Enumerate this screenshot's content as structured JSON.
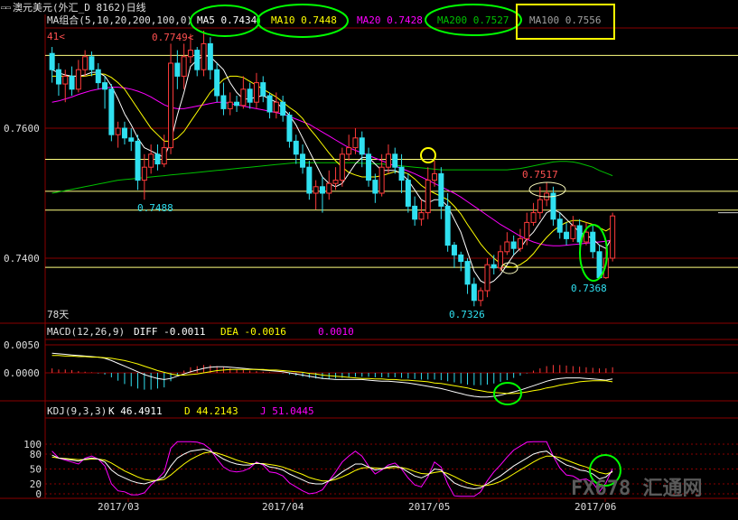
{
  "title": "澳元美元(外汇_D 8162)日线",
  "colors": {
    "bg": "#000000",
    "up": "#ff3b3b",
    "down": "#30e0f0",
    "grid": "#8a0000",
    "ma5": "#ffffff",
    "ma10": "#ffff00",
    "ma20": "#ff00ff",
    "ma200": "#00c000",
    "ma100": "#a0a0a0",
    "hline": "#ffff80",
    "annotate_green": "#00ff00",
    "annotate_yellow": "#ffff00"
  },
  "price_header": {
    "label": "MA组合(5,10,20,200,100,0)",
    "items": [
      {
        "text": "MA5 0.7434",
        "color": "#ffffff"
      },
      {
        "text": "MA10 0.7448",
        "color": "#ffff00"
      },
      {
        "text": "MA20 0.7428",
        "color": "#ff00ff"
      },
      {
        "text": "MA200 0.7527",
        "color": "#00c000"
      },
      {
        "text": "MA100 0.7556",
        "color": "#a0a0a0"
      }
    ]
  },
  "macd_header": {
    "label": "MACD(12,26,9)",
    "diff": "DIFF  -0.0011",
    "dea": "DEA  -0.0016",
    "macd": "0.0010"
  },
  "kdj_header": {
    "label": "KDJ(9,3,3)",
    "k": "K  46.4911",
    "d": "D  44.2143",
    "j": "J  51.0445"
  },
  "chart_data": {
    "type": "candlestick",
    "price_ticks": [
      "0.7600",
      "0.7400"
    ],
    "macd_ticks": [
      "0.0050",
      "0.0000"
    ],
    "kdj_ticks": [
      "100",
      "80",
      "50",
      "20",
      "0"
    ],
    "x_ticks": [
      "2017/03",
      "2017/04",
      "2017/05",
      "2017/06"
    ],
    "annotations": [
      "0.7749",
      "0.7488",
      "0.7517",
      "0.7326",
      "0.7368"
    ],
    "period_label": "78天",
    "price_left_label": "41",
    "horizontal_levels": [
      0.7712,
      0.7552,
      0.7503,
      0.7474,
      0.7386
    ],
    "candles": [
      [
        0.7715,
        0.769,
        0.7725,
        0.767
      ],
      [
        0.769,
        0.7668,
        0.77,
        0.765
      ],
      [
        0.7668,
        0.768,
        0.769,
        0.764
      ],
      [
        0.768,
        0.766,
        0.7695,
        0.765
      ],
      [
        0.766,
        0.769,
        0.7705,
        0.7655
      ],
      [
        0.769,
        0.771,
        0.772,
        0.768
      ],
      [
        0.771,
        0.769,
        0.7718,
        0.768
      ],
      [
        0.769,
        0.767,
        0.77,
        0.766
      ],
      [
        0.767,
        0.766,
        0.768,
        0.763
      ],
      [
        0.766,
        0.759,
        0.7668,
        0.758
      ],
      [
        0.759,
        0.76,
        0.761,
        0.757
      ],
      [
        0.76,
        0.7585,
        0.761,
        0.7575
      ],
      [
        0.7585,
        0.758,
        0.76,
        0.7565
      ],
      [
        0.758,
        0.752,
        0.759,
        0.7505
      ],
      [
        0.752,
        0.754,
        0.756,
        0.749
      ],
      [
        0.754,
        0.756,
        0.7575,
        0.753
      ],
      [
        0.756,
        0.7545,
        0.7575,
        0.7535
      ],
      [
        0.7545,
        0.757,
        0.759,
        0.754
      ],
      [
        0.757,
        0.77,
        0.773,
        0.756
      ],
      [
        0.77,
        0.768,
        0.772,
        0.766
      ],
      [
        0.768,
        0.771,
        0.773,
        0.766
      ],
      [
        0.771,
        0.772,
        0.7745,
        0.77
      ],
      [
        0.772,
        0.769,
        0.7725,
        0.768
      ],
      [
        0.769,
        0.773,
        0.775,
        0.768
      ],
      [
        0.773,
        0.769,
        0.774,
        0.7675
      ],
      [
        0.769,
        0.765,
        0.77,
        0.764
      ],
      [
        0.765,
        0.763,
        0.767,
        0.762
      ],
      [
        0.763,
        0.764,
        0.7655,
        0.762
      ],
      [
        0.764,
        0.7635,
        0.765,
        0.7625
      ],
      [
        0.7635,
        0.766,
        0.768,
        0.763
      ],
      [
        0.766,
        0.764,
        0.767,
        0.763
      ],
      [
        0.764,
        0.767,
        0.7685,
        0.763
      ],
      [
        0.767,
        0.765,
        0.768,
        0.764
      ],
      [
        0.765,
        0.7625,
        0.7655,
        0.7615
      ],
      [
        0.7625,
        0.764,
        0.7655,
        0.7615
      ],
      [
        0.764,
        0.762,
        0.765,
        0.761
      ],
      [
        0.762,
        0.758,
        0.7625,
        0.757
      ],
      [
        0.758,
        0.756,
        0.759,
        0.7545
      ],
      [
        0.756,
        0.754,
        0.7575,
        0.753
      ],
      [
        0.754,
        0.75,
        0.755,
        0.749
      ],
      [
        0.75,
        0.751,
        0.752,
        0.7475
      ],
      [
        0.751,
        0.75,
        0.7525,
        0.747
      ],
      [
        0.75,
        0.7515,
        0.7535,
        0.749
      ],
      [
        0.7515,
        0.752,
        0.754,
        0.7505
      ],
      [
        0.752,
        0.756,
        0.757,
        0.751
      ],
      [
        0.756,
        0.757,
        0.759,
        0.755
      ],
      [
        0.757,
        0.7585,
        0.76,
        0.756
      ],
      [
        0.7585,
        0.756,
        0.7595,
        0.754
      ],
      [
        0.756,
        0.752,
        0.757,
        0.751
      ],
      [
        0.752,
        0.75,
        0.753,
        0.7485
      ],
      [
        0.75,
        0.754,
        0.756,
        0.7495
      ],
      [
        0.754,
        0.756,
        0.7575,
        0.753
      ],
      [
        0.756,
        0.754,
        0.757,
        0.753
      ],
      [
        0.754,
        0.752,
        0.756,
        0.75
      ],
      [
        0.752,
        0.748,
        0.753,
        0.747
      ],
      [
        0.748,
        0.746,
        0.7495,
        0.745
      ],
      [
        0.746,
        0.747,
        0.749,
        0.745
      ],
      [
        0.747,
        0.752,
        0.754,
        0.746
      ],
      [
        0.752,
        0.753,
        0.755,
        0.751
      ],
      [
        0.753,
        0.748,
        0.754,
        0.746
      ],
      [
        0.748,
        0.742,
        0.75,
        0.741
      ],
      [
        0.742,
        0.7405,
        0.7425,
        0.7385
      ],
      [
        0.7405,
        0.7395,
        0.741,
        0.738
      ],
      [
        0.7395,
        0.736,
        0.74,
        0.7345
      ],
      [
        0.736,
        0.7335,
        0.737,
        0.7326
      ],
      [
        0.7335,
        0.735,
        0.7355,
        0.7326
      ],
      [
        0.735,
        0.739,
        0.74,
        0.734
      ],
      [
        0.739,
        0.7385,
        0.7405,
        0.7375
      ],
      [
        0.7385,
        0.741,
        0.742,
        0.738
      ],
      [
        0.741,
        0.7425,
        0.744,
        0.7405
      ],
      [
        0.7425,
        0.7415,
        0.7435,
        0.7405
      ],
      [
        0.7415,
        0.743,
        0.7445,
        0.741
      ],
      [
        0.743,
        0.7455,
        0.747,
        0.742
      ],
      [
        0.7455,
        0.747,
        0.7485,
        0.745
      ],
      [
        0.747,
        0.749,
        0.751,
        0.746
      ],
      [
        0.749,
        0.75,
        0.7517,
        0.748
      ],
      [
        0.75,
        0.746,
        0.751,
        0.745
      ],
      [
        0.746,
        0.744,
        0.747,
        0.743
      ],
      [
        0.744,
        0.743,
        0.7455,
        0.742
      ],
      [
        0.743,
        0.745,
        0.7465,
        0.7425
      ],
      [
        0.745,
        0.7425,
        0.746,
        0.742
      ],
      [
        0.7425,
        0.744,
        0.7455,
        0.742
      ],
      [
        0.744,
        0.741,
        0.745,
        0.74
      ],
      [
        0.741,
        0.737,
        0.742,
        0.7368
      ],
      [
        0.737,
        0.74,
        0.7415,
        0.7368
      ],
      [
        0.74,
        0.7465,
        0.747,
        0.7395
      ]
    ],
    "ma5": [
      0.769,
      0.7685,
      0.7682,
      0.768,
      0.768,
      0.7682,
      0.7686,
      0.7686,
      0.768,
      0.7665,
      0.7645,
      0.7622,
      0.7605,
      0.7585,
      0.757,
      0.7565,
      0.756,
      0.7555,
      0.758,
      0.762,
      0.7655,
      0.7695,
      0.7705,
      0.7712,
      0.771,
      0.77,
      0.769,
      0.767,
      0.7655,
      0.7645,
      0.7645,
      0.7648,
      0.765,
      0.7645,
      0.764,
      0.763,
      0.762,
      0.7605,
      0.7585,
      0.7565,
      0.7545,
      0.7525,
      0.7515,
      0.751,
      0.7515,
      0.753,
      0.7545,
      0.7555,
      0.7555,
      0.7545,
      0.7535,
      0.7535,
      0.7535,
      0.753,
      0.752,
      0.7505,
      0.749,
      0.7485,
      0.749,
      0.749,
      0.748,
      0.746,
      0.744,
      0.741,
      0.738,
      0.7365,
      0.736,
      0.7365,
      0.7375,
      0.739,
      0.7405,
      0.7415,
      0.743,
      0.744,
      0.7455,
      0.747,
      0.7475,
      0.747,
      0.746,
      0.745,
      0.744,
      0.7435,
      0.743,
      0.742,
      0.7415,
      0.7434
    ],
    "ma10": [
      0.768,
      0.768,
      0.768,
      0.768,
      0.768,
      0.768,
      0.7682,
      0.7684,
      0.7683,
      0.7678,
      0.767,
      0.766,
      0.7645,
      0.763,
      0.7615,
      0.76,
      0.759,
      0.758,
      0.758,
      0.7585,
      0.7595,
      0.761,
      0.7625,
      0.764,
      0.7655,
      0.7665,
      0.7675,
      0.768,
      0.768,
      0.7678,
      0.7672,
      0.7666,
      0.766,
      0.7654,
      0.7648,
      0.764,
      0.7632,
      0.7625,
      0.7615,
      0.76,
      0.7588,
      0.7575,
      0.7562,
      0.755,
      0.754,
      0.7532,
      0.7528,
      0.7525,
      0.7525,
      0.7525,
      0.7527,
      0.753,
      0.7533,
      0.7533,
      0.753,
      0.7522,
      0.7512,
      0.7505,
      0.75,
      0.7495,
      0.749,
      0.748,
      0.7468,
      0.7452,
      0.7437,
      0.7422,
      0.741,
      0.74,
      0.7392,
      0.7387,
      0.7386,
      0.739,
      0.7397,
      0.7407,
      0.742,
      0.7432,
      0.7442,
      0.745,
      0.7455,
      0.7458,
      0.7458,
      0.7455,
      0.7452,
      0.7447,
      0.7442,
      0.7448
    ],
    "ma20": [
      0.764,
      0.7642,
      0.7645,
      0.7648,
      0.7652,
      0.7655,
      0.7658,
      0.766,
      0.7662,
      0.7663,
      0.7663,
      0.7662,
      0.766,
      0.7657,
      0.7653,
      0.7648,
      0.7642,
      0.7636,
      0.7632,
      0.763,
      0.763,
      0.7632,
      0.7634,
      0.7636,
      0.7638,
      0.764,
      0.764,
      0.7638,
      0.7636,
      0.7634,
      0.7632,
      0.763,
      0.7628,
      0.7626,
      0.7624,
      0.7622,
      0.7618,
      0.7614,
      0.761,
      0.7606,
      0.76,
      0.7594,
      0.7588,
      0.7582,
      0.7576,
      0.757,
      0.7566,
      0.7562,
      0.7558,
      0.7554,
      0.755,
      0.7546,
      0.7542,
      0.7538,
      0.7534,
      0.753,
      0.7525,
      0.752,
      0.7515,
      0.751,
      0.7505,
      0.75,
      0.7494,
      0.7487,
      0.748,
      0.7473,
      0.7466,
      0.7459,
      0.7452,
      0.7446,
      0.744,
      0.7434,
      0.7429,
      0.7425,
      0.7422,
      0.742,
      0.7419,
      0.7419,
      0.742,
      0.7421,
      0.7422,
      0.7423,
      0.7424,
      0.7425,
      0.7426,
      0.7428
    ],
    "ma200": [
      0.75,
      0.7502,
      0.7504,
      0.7506,
      0.7508,
      0.751,
      0.7512,
      0.7514,
      0.7516,
      0.7518,
      0.752,
      0.7521,
      0.7522,
      0.7523,
      0.7524,
      0.7525,
      0.7526,
      0.7527,
      0.7528,
      0.7529,
      0.753,
      0.7531,
      0.7532,
      0.7533,
      0.7534,
      0.7535,
      0.7536,
      0.7537,
      0.7538,
      0.7539,
      0.754,
      0.7541,
      0.7542,
      0.7543,
      0.7544,
      0.7545,
      0.7546,
      0.7547,
      0.7547,
      0.7547,
      0.7547,
      0.7547,
      0.7547,
      0.7547,
      0.7547,
      0.7547,
      0.7547,
      0.7546,
      0.7546,
      0.7545,
      0.7545,
      0.7544,
      0.7543,
      0.7542,
      0.7541,
      0.754,
      0.7539,
      0.7538,
      0.7537,
      0.7536,
      0.7536,
      0.7536,
      0.7536,
      0.7536,
      0.7536,
      0.7536,
      0.7536,
      0.7536,
      0.7536,
      0.7536,
      0.7537,
      0.7538,
      0.754,
      0.7542,
      0.7544,
      0.7546,
      0.7548,
      0.7549,
      0.7549,
      0.7548,
      0.7546,
      0.7543,
      0.754,
      0.7535,
      0.7531,
      0.7527
    ],
    "macd_hist": [
      0.0008,
      0.0006,
      0.0006,
      0.0005,
      0.0003,
      0.0002,
      0.0001,
      -0.0001,
      -0.0003,
      -0.0008,
      -0.0014,
      -0.002,
      -0.0024,
      -0.0028,
      -0.003,
      -0.003,
      -0.0028,
      -0.0026,
      -0.0015,
      -0.0004,
      0.0004,
      0.001,
      0.0012,
      0.0014,
      0.0014,
      0.0012,
      0.001,
      0.0008,
      0.0006,
      0.0005,
      0.0004,
      0.0003,
      0.0002,
      0.0001,
      0.0,
      -0.0001,
      -0.0003,
      -0.0005,
      -0.0007,
      -0.0009,
      -0.001,
      -0.0011,
      -0.0011,
      -0.001,
      -0.0009,
      -0.0008,
      -0.0007,
      -0.0007,
      -0.0007,
      -0.0008,
      -0.0008,
      -0.0008,
      -0.0008,
      -0.0009,
      -0.001,
      -0.0011,
      -0.0012,
      -0.0012,
      -0.0012,
      -0.0013,
      -0.0015,
      -0.0017,
      -0.0019,
      -0.0021,
      -0.0022,
      -0.0022,
      -0.0021,
      -0.0019,
      -0.0016,
      -0.0013,
      -0.0009,
      -0.0005,
      -0.0001,
      0.0004,
      0.0008,
      0.0012,
      0.0014,
      0.0014,
      0.0013,
      0.0012,
      0.0011,
      0.001,
      0.0009,
      0.0008,
      0.0008,
      0.001
    ],
    "macd_diff": [
      0.0035,
      0.0034,
      0.0033,
      0.0032,
      0.0031,
      0.003,
      0.0029,
      0.0028,
      0.0026,
      0.0022,
      0.0017,
      0.0012,
      0.0007,
      0.0002,
      -0.0003,
      -0.0007,
      -0.001,
      -0.0012,
      -0.001,
      -0.0006,
      -0.0002,
      0.0002,
      0.0005,
      0.0008,
      0.001,
      0.0011,
      0.0011,
      0.001,
      0.0009,
      0.0008,
      0.0007,
      0.0006,
      0.0005,
      0.0004,
      0.0003,
      0.0002,
      0.0,
      -0.0002,
      -0.0004,
      -0.0006,
      -0.0008,
      -0.001,
      -0.0011,
      -0.0012,
      -0.0012,
      -0.0012,
      -0.0012,
      -0.0012,
      -0.0013,
      -0.0014,
      -0.0015,
      -0.0015,
      -0.0016,
      -0.0017,
      -0.0018,
      -0.002,
      -0.0022,
      -0.0024,
      -0.0026,
      -0.0028,
      -0.0031,
      -0.0034,
      -0.0037,
      -0.004,
      -0.0042,
      -0.0043,
      -0.0043,
      -0.0042,
      -0.004,
      -0.0037,
      -0.0034,
      -0.0031,
      -0.0027,
      -0.0023,
      -0.0019,
      -0.0015,
      -0.0012,
      -0.001,
      -0.0009,
      -0.0009,
      -0.0009,
      -0.001,
      -0.0011,
      -0.0012,
      -0.0013,
      -0.0011
    ],
    "macd_dea": [
      0.0031,
      0.0031,
      0.003,
      0.003,
      0.0029,
      0.0029,
      0.0028,
      0.0028,
      0.0027,
      0.0026,
      0.0024,
      0.0022,
      0.0019,
      0.0016,
      0.0012,
      0.0008,
      0.0004,
      0.0001,
      -0.0002,
      -0.0004,
      -0.0004,
      -0.0003,
      -0.0002,
      0.0,
      0.0002,
      0.0004,
      0.0005,
      0.0006,
      0.0006,
      0.0006,
      0.0006,
      0.0006,
      0.0006,
      0.0005,
      0.0005,
      0.0004,
      0.0003,
      0.0002,
      0.0001,
      -0.0001,
      -0.0002,
      -0.0004,
      -0.0005,
      -0.0006,
      -0.0007,
      -0.0008,
      -0.0009,
      -0.001,
      -0.001,
      -0.0011,
      -0.0011,
      -0.0012,
      -0.0012,
      -0.0013,
      -0.0013,
      -0.0014,
      -0.0015,
      -0.0016,
      -0.0018,
      -0.0019,
      -0.0021,
      -0.0023,
      -0.0025,
      -0.0027,
      -0.003,
      -0.0032,
      -0.0034,
      -0.0035,
      -0.0036,
      -0.0037,
      -0.0037,
      -0.0036,
      -0.0034,
      -0.0032,
      -0.003,
      -0.0027,
      -0.0025,
      -0.0022,
      -0.002,
      -0.0018,
      -0.0016,
      -0.0015,
      -0.0014,
      -0.0014,
      -0.0014,
      -0.0016
    ],
    "kdj_k": [
      78,
      72,
      70,
      68,
      66,
      70,
      72,
      70,
      64,
      48,
      38,
      32,
      26,
      22,
      20,
      24,
      28,
      34,
      56,
      72,
      80,
      86,
      88,
      90,
      86,
      78,
      70,
      64,
      60,
      58,
      58,
      62,
      60,
      54,
      52,
      48,
      40,
      34,
      28,
      22,
      20,
      20,
      26,
      34,
      44,
      52,
      60,
      60,
      54,
      48,
      50,
      54,
      56,
      52,
      44,
      36,
      32,
      38,
      50,
      48,
      34,
      22,
      16,
      12,
      10,
      12,
      20,
      28,
      36,
      46,
      56,
      64,
      72,
      80,
      84,
      86,
      76,
      66,
      58,
      54,
      48,
      46,
      40,
      30,
      34,
      46
    ],
    "kdj_d": [
      74,
      72,
      71,
      70,
      69,
      69,
      70,
      70,
      68,
      62,
      54,
      46,
      40,
      34,
      29,
      27,
      27,
      29,
      38,
      49,
      60,
      69,
      76,
      82,
      84,
      82,
      78,
      73,
      68,
      64,
      61,
      61,
      61,
      59,
      57,
      54,
      49,
      44,
      39,
      33,
      29,
      26,
      26,
      29,
      34,
      40,
      47,
      52,
      53,
      52,
      51,
      52,
      53,
      53,
      50,
      45,
      41,
      40,
      43,
      45,
      41,
      35,
      28,
      22,
      18,
      16,
      17,
      20,
      25,
      32,
      40,
      48,
      56,
      64,
      71,
      76,
      76,
      73,
      68,
      63,
      58,
      54,
      49,
      43,
      40,
      44
    ],
    "kdj_j": [
      86,
      72,
      68,
      64,
      60,
      72,
      76,
      70,
      56,
      20,
      6,
      4,
      -2,
      -2,
      2,
      18,
      30,
      44,
      92,
      108,
      110,
      110,
      104,
      100,
      90,
      70,
      54,
      46,
      44,
      46,
      52,
      64,
      58,
      44,
      42,
      36,
      22,
      14,
      6,
      0,
      2,
      8,
      26,
      44,
      64,
      76,
      86,
      76,
      56,
      40,
      48,
      58,
      62,
      50,
      32,
      18,
      14,
      34,
      64,
      54,
      20,
      -4,
      -8,
      -8,
      -6,
      4,
      26,
      44,
      58,
      74,
      88,
      96,
      104,
      112,
      110,
      106,
      76,
      52,
      38,
      36,
      28,
      30,
      22,
      4,
      22,
      51
    ]
  }
}
